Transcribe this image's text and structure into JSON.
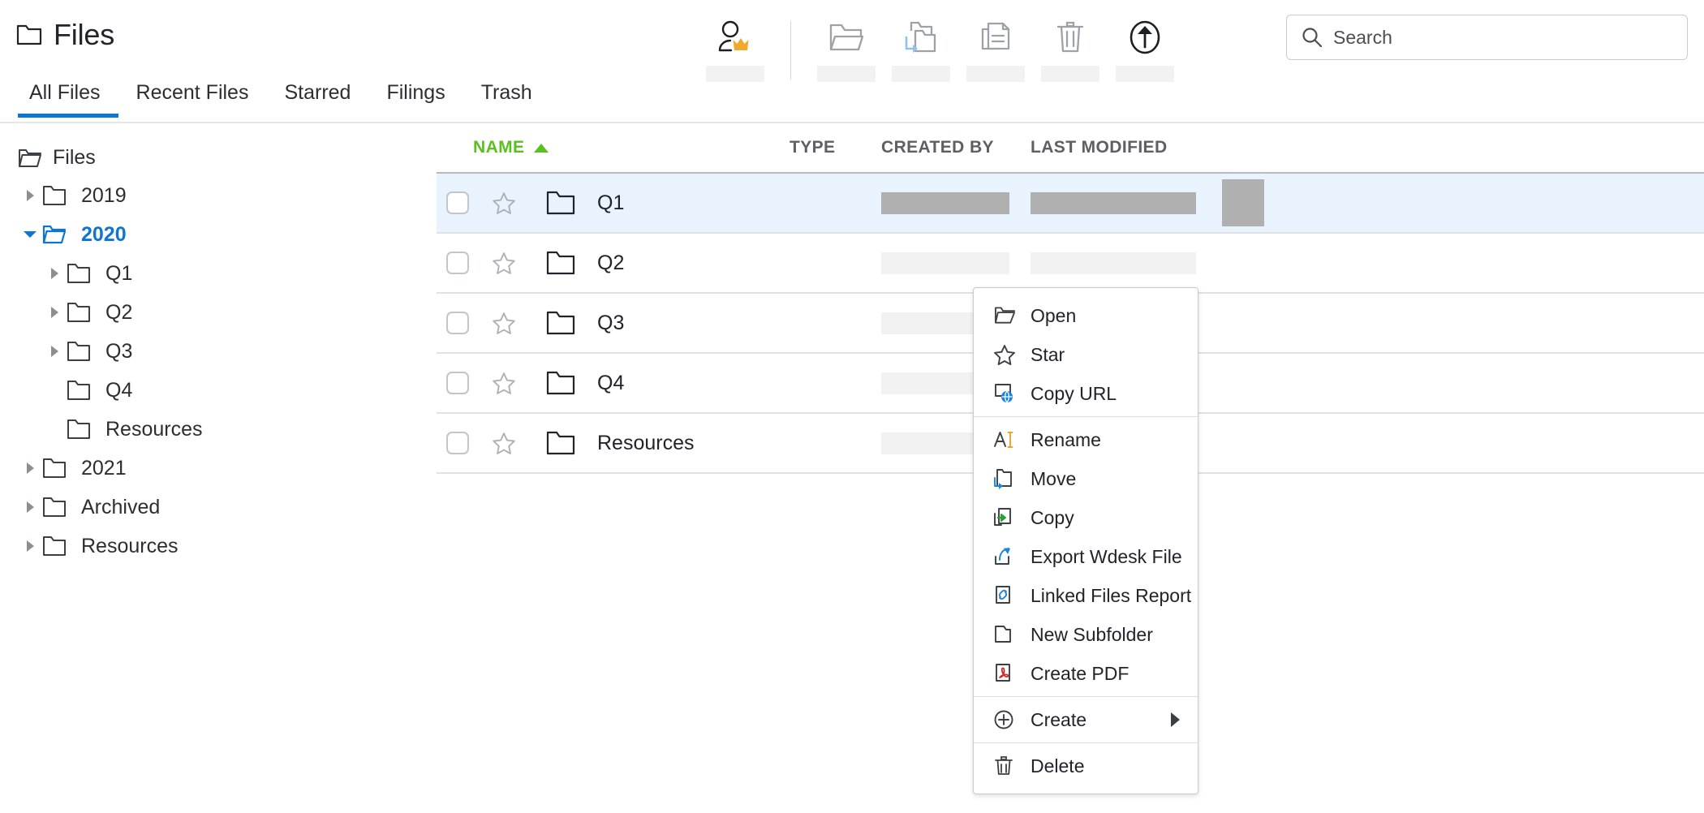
{
  "header": {
    "title": "Files",
    "folder_icon": "folder-icon"
  },
  "toolbar": {
    "buttons": [
      {
        "icon": "user-crown-icon",
        "label": ""
      },
      {
        "icon": "folder-open-icon",
        "label": ""
      },
      {
        "icon": "folder-move-icon",
        "label": ""
      },
      {
        "icon": "copy-documents-icon",
        "label": ""
      },
      {
        "icon": "trash-icon",
        "label": ""
      },
      {
        "icon": "upload-circle-icon",
        "label": ""
      }
    ]
  },
  "search": {
    "placeholder": "Search",
    "value": "",
    "icon": "search-icon"
  },
  "tabs": [
    {
      "label": "All Files",
      "active": true
    },
    {
      "label": "Recent Files",
      "active": false
    },
    {
      "label": "Starred",
      "active": false
    },
    {
      "label": "Filings",
      "active": false
    },
    {
      "label": "Trash",
      "active": false
    }
  ],
  "sidebar": {
    "root": {
      "label": "Files",
      "icon": "folder-open-icon"
    },
    "items": [
      {
        "label": "2019",
        "level": 1,
        "expandable": true,
        "expanded": false,
        "selected": false
      },
      {
        "label": "2020",
        "level": 1,
        "expandable": true,
        "expanded": true,
        "selected": true
      },
      {
        "label": "Q1",
        "level": 2,
        "expandable": true,
        "expanded": false,
        "selected": false
      },
      {
        "label": "Q2",
        "level": 2,
        "expandable": true,
        "expanded": false,
        "selected": false
      },
      {
        "label": "Q3",
        "level": 2,
        "expandable": true,
        "expanded": false,
        "selected": false
      },
      {
        "label": "Q4",
        "level": 2,
        "expandable": false,
        "expanded": false,
        "selected": false
      },
      {
        "label": "Resources",
        "level": 2,
        "expandable": false,
        "expanded": false,
        "selected": false
      },
      {
        "label": "2021",
        "level": 1,
        "expandable": true,
        "expanded": false,
        "selected": false
      },
      {
        "label": "Archived",
        "level": 1,
        "expandable": true,
        "expanded": false,
        "selected": false
      },
      {
        "label": "Resources",
        "level": 1,
        "expandable": true,
        "expanded": false,
        "selected": false
      }
    ]
  },
  "table": {
    "columns": [
      {
        "key": "name",
        "label": "NAME",
        "sorted": true,
        "sort_direction": "asc",
        "color": "#58c120"
      },
      {
        "key": "type",
        "label": "TYPE",
        "sorted": false
      },
      {
        "key": "created",
        "label": "CREATED BY",
        "sorted": false
      },
      {
        "key": "modified",
        "label": "LAST MODIFIED",
        "sorted": false
      }
    ],
    "rows": [
      {
        "name": "Q1",
        "icon": "folder-icon",
        "selected": true,
        "starred": false,
        "checked": false
      },
      {
        "name": "Q2",
        "icon": "folder-icon",
        "selected": false,
        "starred": false,
        "checked": false
      },
      {
        "name": "Q3",
        "icon": "folder-icon",
        "selected": false,
        "starred": false,
        "checked": false
      },
      {
        "name": "Q4",
        "icon": "folder-icon",
        "selected": false,
        "starred": false,
        "checked": false
      },
      {
        "name": "Resources",
        "icon": "folder-icon",
        "selected": false,
        "starred": false,
        "checked": false
      }
    ]
  },
  "context_menu": {
    "groups": [
      {
        "items": [
          {
            "label": "Open",
            "icon": "folder-open-icon"
          },
          {
            "label": "Star",
            "icon": "star-icon"
          },
          {
            "label": "Copy URL",
            "icon": "copy-url-globe-icon"
          }
        ]
      },
      {
        "items": [
          {
            "label": "Rename",
            "icon": "rename-text-cursor-icon"
          },
          {
            "label": "Move",
            "icon": "move-folder-icon"
          },
          {
            "label": "Copy",
            "icon": "copy-arrow-icon"
          },
          {
            "label": "Export Wdesk File",
            "icon": "export-arrow-icon"
          },
          {
            "label": "Linked Files Report",
            "icon": "link-document-icon"
          },
          {
            "label": "New Subfolder",
            "icon": "new-folder-icon"
          },
          {
            "label": "Create PDF",
            "icon": "pdf-icon"
          }
        ]
      },
      {
        "items": [
          {
            "label": "Create",
            "icon": "plus-circle-icon",
            "has_submenu": true
          }
        ]
      },
      {
        "items": [
          {
            "label": "Delete",
            "icon": "trash-icon"
          }
        ]
      }
    ]
  },
  "colors": {
    "accent_blue": "#0e76d1",
    "sort_green": "#58c120",
    "selected_row": "#e8f3fd",
    "skeleton_light": "#f2f2f2",
    "skeleton_dark": "#b0b0b0",
    "crown_gold": "#f0a92c",
    "pdf_red": "#d62728"
  }
}
